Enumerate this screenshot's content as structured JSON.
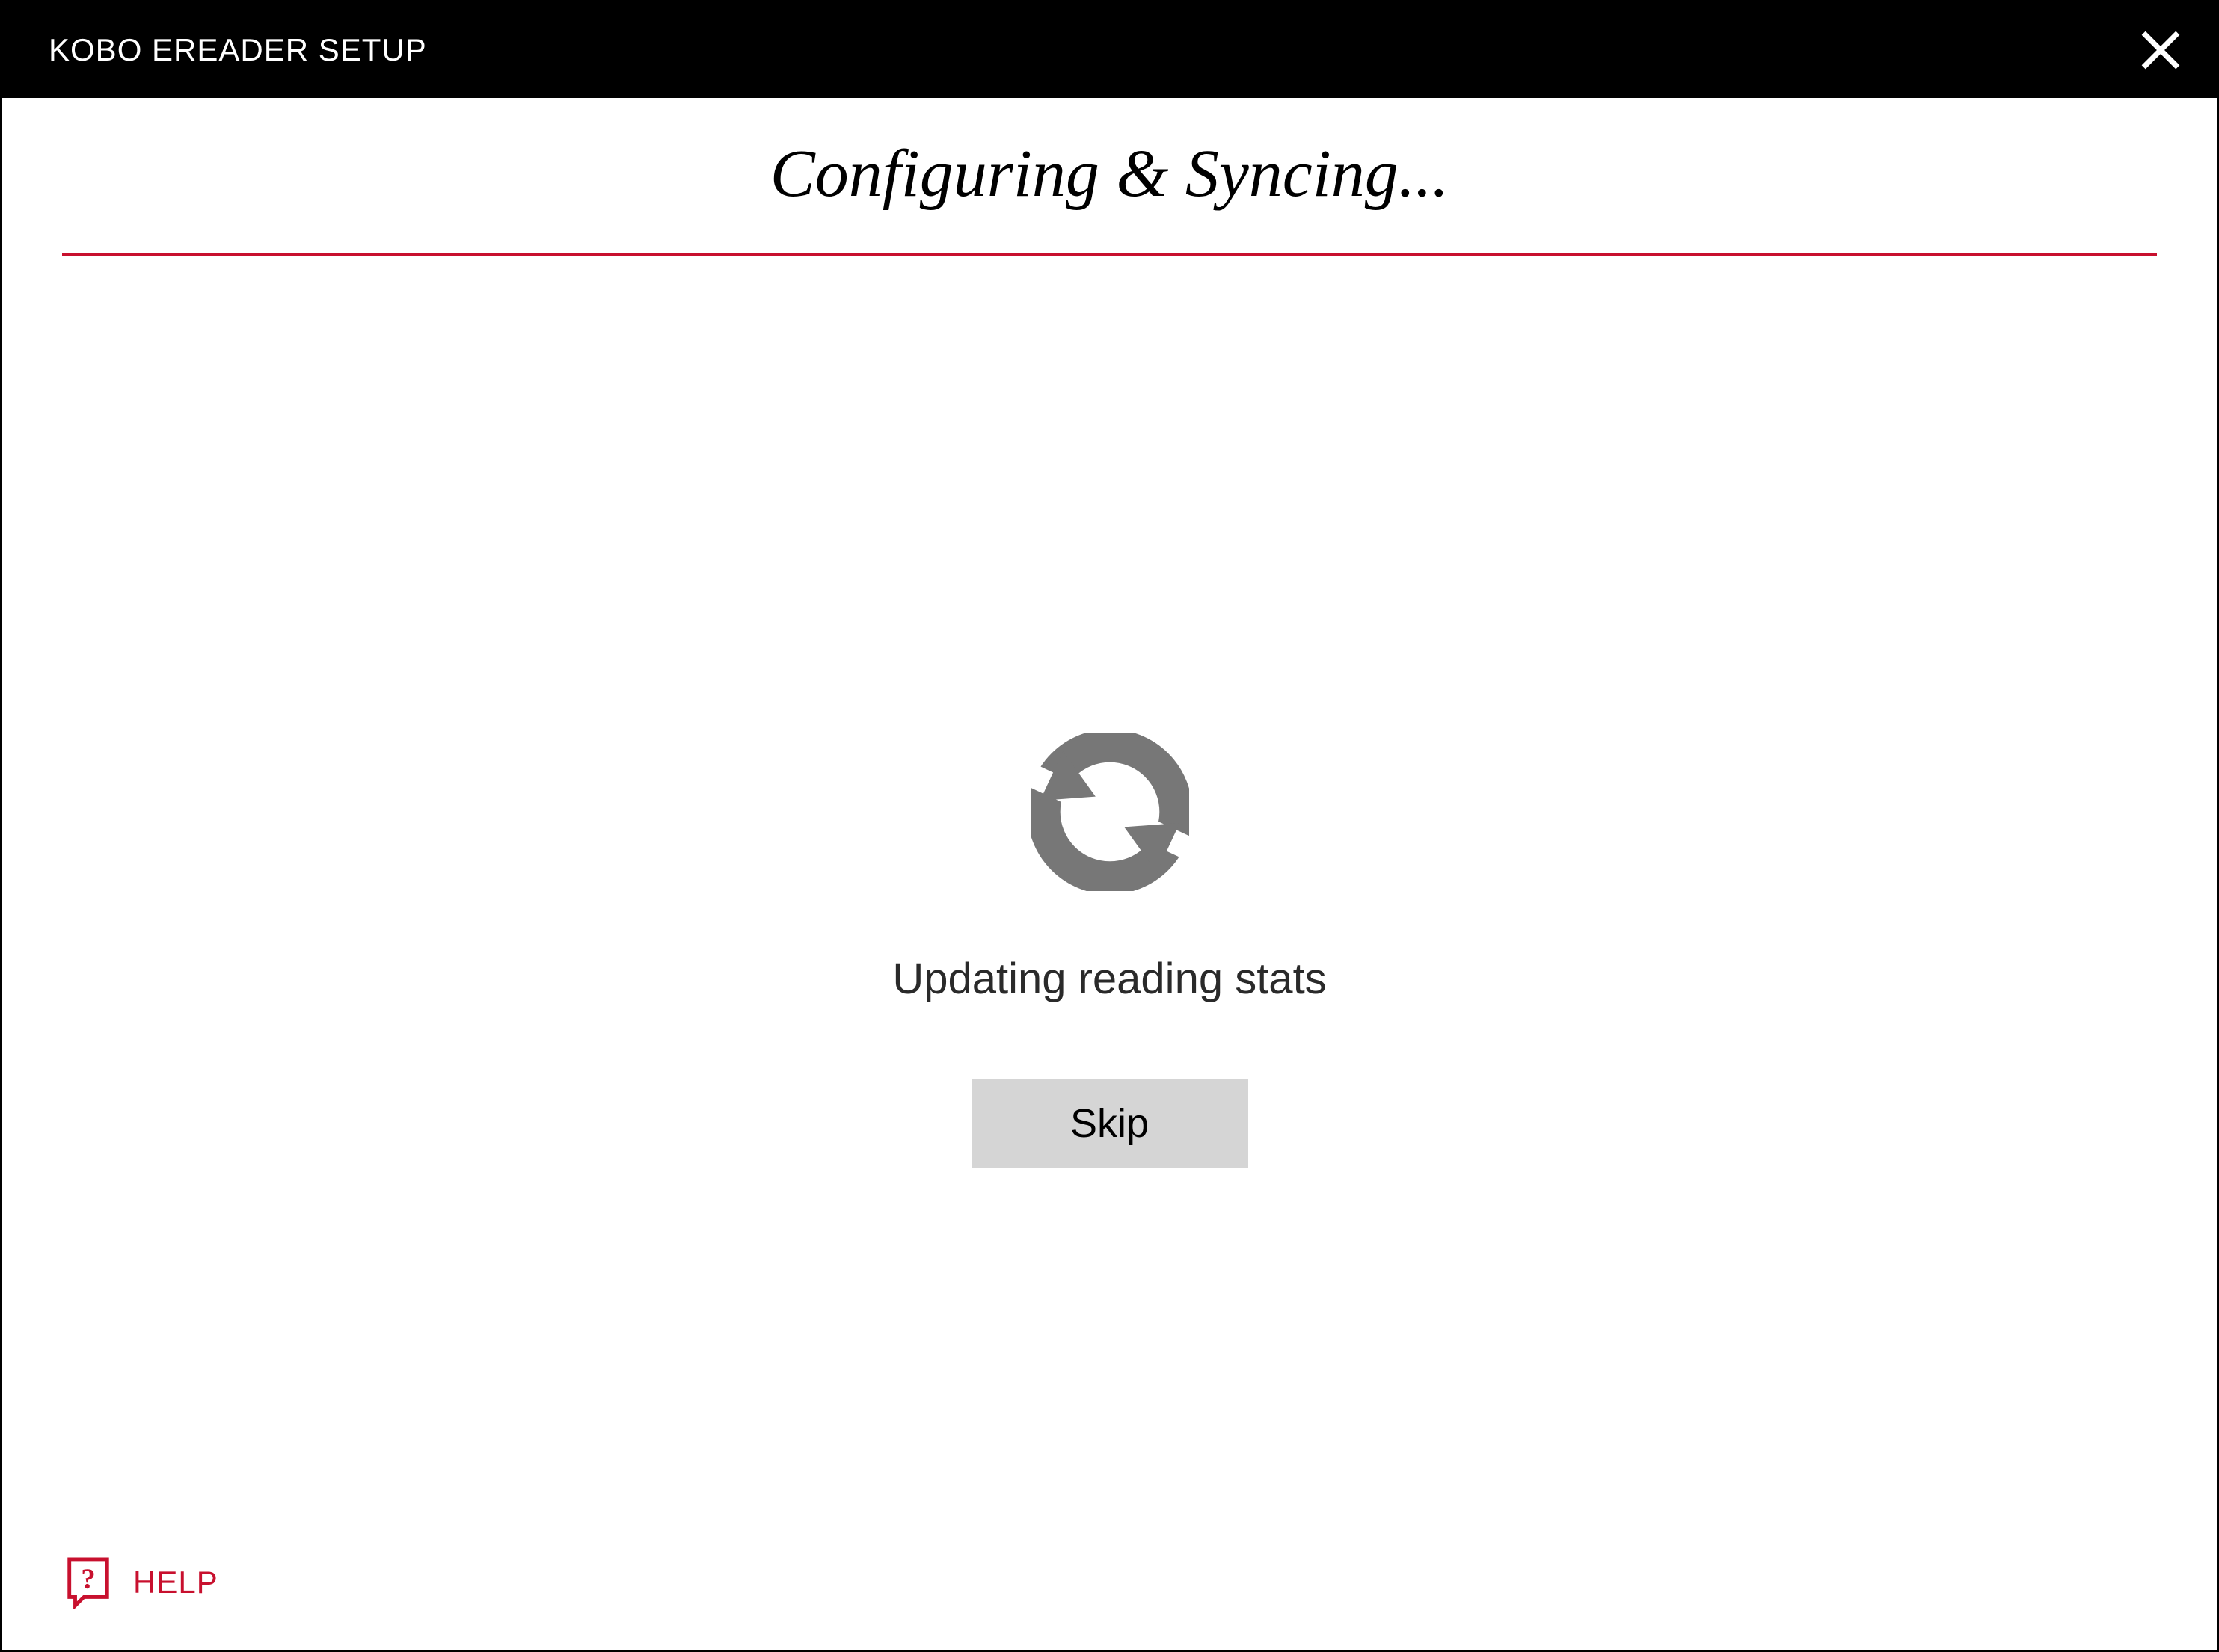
{
  "titleBar": {
    "title": "KOBO EREADER SETUP"
  },
  "main": {
    "heading": "Configuring & Syncing...",
    "statusText": "Updating reading stats",
    "skipLabel": "Skip"
  },
  "footer": {
    "helpLabel": "HELP"
  },
  "colors": {
    "accent": "#c8102e",
    "buttonBg": "#d5d5d5",
    "iconGray": "#777777"
  }
}
